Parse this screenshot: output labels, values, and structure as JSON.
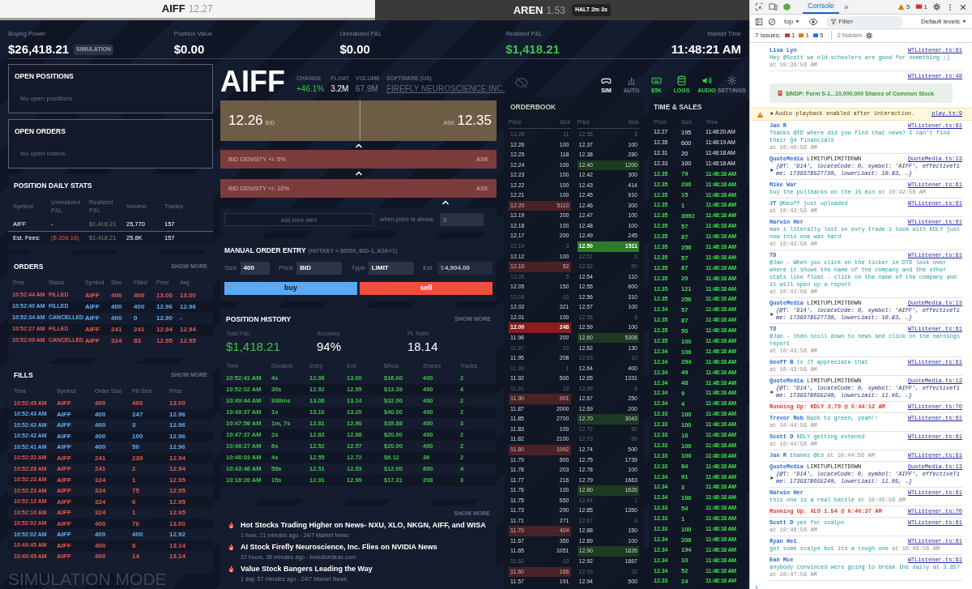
{
  "symbol_tabs": [
    {
      "symbol": "AIFF",
      "price": "12.27",
      "selected": true
    },
    {
      "symbol": "AREN",
      "price": "1.53",
      "badge": "HALT 2m 3s",
      "selected": false
    }
  ],
  "account": [
    {
      "label": "Buying Power",
      "value": "$26,418.21",
      "badge": "SIMULATION",
      "positive": false
    },
    {
      "label": "Position Value",
      "value": "$0.00",
      "positive": false
    },
    {
      "label": "Unrealized P&L",
      "value": "$0.00",
      "positive": false
    },
    {
      "label": "Realized P&L",
      "value": "$1,418.21",
      "positive": true
    },
    {
      "label": "Market Time",
      "value": "11:48:21 AM",
      "positive": false
    }
  ],
  "ticker": {
    "symbol": "AIFF",
    "stats": [
      {
        "label": "CHANGE",
        "value": "+46.1%",
        "positive": true,
        "muted": false
      },
      {
        "label": "FLOAT",
        "value": "3.2M",
        "positive": false,
        "muted": false
      },
      {
        "label": "VOLUME",
        "value": "67.9M",
        "positive": false,
        "muted": true
      }
    ],
    "company_label": "SOFTWARE (US)",
    "company": "FIREFLY NEUROSCIENCE INC.",
    "tools": [
      {
        "label": "SIM",
        "kind": "gamepad",
        "active": false,
        "muted": false
      },
      {
        "label": "AUTO",
        "kind": "chart",
        "active": false,
        "muted": true
      },
      {
        "label": "$5K",
        "kind": "keyboard",
        "active": true,
        "muted": false
      },
      {
        "label": "LOGS",
        "kind": "database",
        "active": true,
        "muted": false
      },
      {
        "label": "AUDIO",
        "kind": "speaker",
        "active": true,
        "muted": false
      },
      {
        "label": "SETTINGS",
        "kind": "gear",
        "active": false,
        "muted": true
      }
    ]
  },
  "quote": {
    "bid": "12.26",
    "bid_label": "BID",
    "ask_label": "ASK",
    "ask": "12.35"
  },
  "density": [
    {
      "label": "BID DENSITY +/- 5%",
      "right": "ASK"
    },
    {
      "label": "BID DENSITY +/- 10%",
      "right": "ASK"
    }
  ],
  "price_alert": {
    "placeholder": "add price alert",
    "condition": "when price is above",
    "price_placeholder": "$"
  },
  "order_entry": {
    "title": "MANUAL ORDER ENTRY",
    "hint": "(HOTKEY = $5000, BID-1, ASK+1)",
    "fields": [
      {
        "label": "Size",
        "value": "400",
        "disabled": false
      },
      {
        "label": "Price",
        "value": "BID",
        "disabled": false
      },
      {
        "label": "Type",
        "value": "LIMIT",
        "disabled": false
      },
      {
        "label": "Est.",
        "prefix": "$",
        "value": "4,904.00",
        "disabled": true
      }
    ],
    "buttons": [
      {
        "label": "buy",
        "kind": "buy"
      },
      {
        "label": "sell",
        "kind": "sell"
      }
    ]
  },
  "position_history": {
    "title": "POSITION HISTORY",
    "show_more": "SHOW MORE",
    "summary": [
      {
        "label": "Total P&L",
        "value": "$1,418.21",
        "positive": true
      },
      {
        "label": "Accuracy",
        "value": "94%",
        "positive": false
      },
      {
        "label": "PL Ratio",
        "value": "18.14",
        "positive": false
      }
    ],
    "columns": [
      "Time",
      "Duration",
      "Entry",
      "Exit",
      "$Real",
      "Shares",
      "Trades"
    ],
    "rows": [
      [
        "10:52:41 AM",
        "4s",
        "12.96",
        "13.00",
        "$16.00",
        "400",
        "2"
      ],
      [
        "10:52:02 AM",
        "30s",
        "12.92",
        "12.95",
        "$13.39",
        "400",
        "4"
      ],
      [
        "10:49:44 AM",
        "938ms",
        "13.06",
        "13.14",
        "$32.00",
        "400",
        "2"
      ],
      [
        "10:49:37 AM",
        "1s",
        "13.10",
        "13.20",
        "$40.00",
        "400",
        "2"
      ],
      [
        "10:47:56 AM",
        "1m, 7s",
        "12.81",
        "12.90",
        "$35.88",
        "400",
        "3"
      ],
      [
        "10:47:37 AM",
        "2s",
        "12.83",
        "12.88",
        "$20.00",
        "400",
        "2"
      ],
      [
        "10:46:27 AM",
        "6s",
        "12.52",
        "12.57",
        "$20.00",
        "400",
        "2"
      ],
      [
        "10:46:03 AM",
        "4s",
        "12.55",
        "12.72",
        "$6.12",
        "36",
        "2"
      ],
      [
        "10:43:46 AM",
        "58s",
        "12.51",
        "12.53",
        "$12.00",
        "800",
        "4"
      ],
      [
        "10:18:20 AM",
        "15s",
        "12.91",
        "12.99",
        "$17.31",
        "208",
        "3"
      ]
    ],
    "more": "..."
  },
  "news": {
    "show_more": "SHOW MORE",
    "items": [
      {
        "title": "Hot Stocks Trading Higher on News- NXU, XLO, NKGN, AIFF, and WISA",
        "meta": "1 hour, 21 minutes ago - 24/7 Market News"
      },
      {
        "title": "AI Stock Firefly Neuroscience, Inc. Flies on NVIDIA News",
        "meta": "22 hours, 38 minutes ago - Investorideas.com"
      },
      {
        "title": "Value Stock Bangers Leading the Way",
        "meta": "1 day, 57 minutes ago - 24/7 Market News"
      }
    ]
  },
  "empty_panels": [
    {
      "title": "OPEN POSITIONS",
      "empty": "No open positions."
    },
    {
      "title": "OPEN ORDERS",
      "empty": "No open orders."
    }
  ],
  "daily_stats": {
    "title": "POSITION DAILY STATS",
    "columns": [
      "Symbol",
      "Unrealized P&L",
      "Realized P&L",
      "Volume",
      "Trades"
    ],
    "rows": [
      {
        "kind": "position",
        "cells": [
          "AIFF",
          "-",
          "$1,418.21",
          "25,770",
          "157"
        ]
      },
      {
        "kind": "fees",
        "cells": [
          "Est. Fees:",
          "($-206.16)",
          "$1,418.21",
          "25.8K",
          "157"
        ]
      }
    ]
  },
  "orders": {
    "title": "ORDERS",
    "show_more": "SHOW MORE",
    "columns": [
      "Time",
      "Status",
      "Symbol",
      "Size",
      "Filled",
      "Price",
      "Avg"
    ],
    "rows": [
      {
        "kind": "sell",
        "cells": [
          "10:52:44 AM",
          "FILLED",
          "AIFF",
          "400",
          "400",
          "13.00",
          "13.00"
        ]
      },
      {
        "kind": "buy",
        "cells": [
          "10:52:40 AM",
          "FILLED",
          "AIFF",
          "400",
          "400",
          "12.96",
          "12.96"
        ]
      },
      {
        "kind": "buy",
        "cells": [
          "10:52:34 AM",
          "CANCELLED",
          "AIFF",
          "400",
          "0",
          "12.90",
          "-"
        ]
      },
      {
        "kind": "sell",
        "cells": [
          "10:52:27 AM",
          "FILLED",
          "AIFF",
          "241",
          "241",
          "12.94",
          "12.94"
        ]
      },
      {
        "kind": "sell",
        "cells": [
          "10:52:09 AM",
          "CANCELLED",
          "AIFF",
          "324",
          "83",
          "12.95",
          "12.95"
        ]
      }
    ],
    "more": "..."
  },
  "fills": {
    "title": "FILLS",
    "show_more": "SHOW MORE",
    "columns": [
      "Time",
      "Symbol",
      "Order Size",
      "Fill Size",
      "Price"
    ],
    "rows": [
      {
        "kind": "sell",
        "cells": [
          "10:52:45 AM",
          "AIFF",
          "400",
          "400",
          "13.00"
        ]
      },
      {
        "kind": "buy",
        "cells": [
          "10:52:43 AM",
          "AIFF",
          "400",
          "247",
          "12.96"
        ]
      },
      {
        "kind": "buy",
        "cells": [
          "10:52:42 AM",
          "AIFF",
          "400",
          "3",
          "12.96"
        ]
      },
      {
        "kind": "buy",
        "cells": [
          "10:52:42 AM",
          "AIFF",
          "400",
          "100",
          "12.96"
        ]
      },
      {
        "kind": "buy",
        "cells": [
          "10:52:41 AM",
          "AIFF",
          "400",
          "50",
          "12.96"
        ]
      },
      {
        "kind": "sell",
        "cells": [
          "10:52:32 AM",
          "AIFF",
          "241",
          "239",
          "12.94"
        ]
      },
      {
        "kind": "sell",
        "cells": [
          "10:52:28 AM",
          "AIFF",
          "241",
          "2",
          "12.94"
        ]
      },
      {
        "kind": "sell",
        "cells": [
          "10:52:23 AM",
          "AIFF",
          "324",
          "1",
          "12.95"
        ]
      },
      {
        "kind": "sell",
        "cells": [
          "10:52:23 AM",
          "AIFF",
          "324",
          "75",
          "12.95"
        ]
      },
      {
        "kind": "sell",
        "cells": [
          "10:52:12 AM",
          "AIFF",
          "324",
          "6",
          "12.95"
        ]
      },
      {
        "kind": "sell",
        "cells": [
          "10:52:10 AM",
          "AIFF",
          "324",
          "1",
          "12.95"
        ]
      },
      {
        "kind": "sell",
        "cells": [
          "10:52:02 AM",
          "AIFF",
          "400",
          "76",
          "13.00"
        ]
      },
      {
        "kind": "buy",
        "cells": [
          "10:52:02 AM",
          "AIFF",
          "400",
          "400",
          "12.92"
        ]
      },
      {
        "kind": "sell",
        "cells": [
          "10:49:45 AM",
          "AIFF",
          "400",
          "8",
          "13.14"
        ]
      },
      {
        "kind": "sell",
        "cells": [
          "10:49:45 AM",
          "AIFF",
          "400",
          "14",
          "13.14"
        ]
      }
    ],
    "more": "..."
  },
  "simulation_banner": "SIMULATION MODE",
  "orderbook": {
    "title": "ORDERBOOK",
    "columns": [
      "Price",
      "Size",
      "Price",
      "Size"
    ],
    "bids": [
      {
        "price": "12.26",
        "size": "11",
        "kind": "dim"
      },
      {
        "price": "12.26",
        "size": "100",
        "kind": "plain"
      },
      {
        "price": "12.25",
        "size": "118",
        "kind": "plain"
      },
      {
        "price": "12.24",
        "size": "100",
        "kind": "plain"
      },
      {
        "price": "12.23",
        "size": "100",
        "kind": "plain"
      },
      {
        "price": "12.22",
        "size": "100",
        "kind": "plain"
      },
      {
        "price": "12.21",
        "size": "100",
        "kind": "plain"
      },
      {
        "price": "12.20",
        "size": "5110",
        "kind": "tint"
      },
      {
        "price": "12.19",
        "size": "200",
        "kind": "plain"
      },
      {
        "price": "12.18",
        "size": "100",
        "kind": "plain"
      },
      {
        "price": "12.17",
        "size": "200",
        "kind": "plain"
      },
      {
        "price": "12.14",
        "size": "3",
        "kind": "dim"
      },
      {
        "price": "12.12",
        "size": "100",
        "kind": "plain"
      },
      {
        "price": "12.10",
        "size": "52",
        "kind": "tint"
      },
      {
        "price": "12.09",
        "size": "5",
        "kind": "dim"
      },
      {
        "price": "12.05",
        "size": "150",
        "kind": "plain"
      },
      {
        "price": "12.04",
        "size": "10",
        "kind": "dim"
      },
      {
        "price": "12.02",
        "size": "321",
        "kind": "plain"
      },
      {
        "price": "12.01",
        "size": "100",
        "kind": "plain"
      },
      {
        "price": "12.00",
        "size": "248",
        "kind": "strong"
      },
      {
        "price": "11.98",
        "size": "200",
        "kind": "plain"
      },
      {
        "price": "11.97",
        "size": "10",
        "kind": "dim"
      },
      {
        "price": "11.95",
        "size": "208",
        "kind": "plain"
      },
      {
        "price": "11.93",
        "size": "1",
        "kind": "dim"
      },
      {
        "price": "11.92",
        "size": "500",
        "kind": "plain"
      },
      {
        "price": "11.91",
        "size": "10",
        "kind": "dim"
      },
      {
        "price": "11.90",
        "size": "901",
        "kind": "tint"
      },
      {
        "price": "11.87",
        "size": "2000",
        "kind": "plain"
      },
      {
        "price": "11.85",
        "size": "2700",
        "kind": "plain"
      },
      {
        "price": "11.83",
        "size": "100",
        "kind": "plain"
      },
      {
        "price": "11.82",
        "size": "2100",
        "kind": "plain"
      },
      {
        "price": "11.80",
        "size": "1092",
        "kind": "tint"
      },
      {
        "price": "11.79",
        "size": "500",
        "kind": "plain"
      },
      {
        "price": "11.78",
        "size": "203",
        "kind": "plain"
      },
      {
        "price": "11.77",
        "size": "216",
        "kind": "plain"
      },
      {
        "price": "11.76",
        "size": "100",
        "kind": "plain"
      },
      {
        "price": "11.75",
        "size": "650",
        "kind": "plain"
      },
      {
        "price": "11.73",
        "size": "290",
        "kind": "plain"
      },
      {
        "price": "11.71",
        "size": "271",
        "kind": "plain"
      },
      {
        "price": "11.70",
        "size": "404",
        "kind": "tint"
      },
      {
        "price": "11.67",
        "size": "350",
        "kind": "plain"
      },
      {
        "price": "11.65",
        "size": "1051",
        "kind": "plain"
      },
      {
        "price": "11.61",
        "size": "10",
        "kind": "dim"
      },
      {
        "price": "11.60",
        "size": "166",
        "kind": "tint"
      },
      {
        "price": "11.57",
        "size": "191",
        "kind": "plain"
      }
    ],
    "asks": [
      {
        "price": "12.35",
        "size": "3",
        "kind": "dim"
      },
      {
        "price": "12.37",
        "size": "100",
        "kind": "plain"
      },
      {
        "price": "12.38",
        "size": "280",
        "kind": "plain"
      },
      {
        "price": "12.40",
        "size": "1200",
        "kind": "tint"
      },
      {
        "price": "12.42",
        "size": "300",
        "kind": "plain"
      },
      {
        "price": "12.43",
        "size": "414",
        "kind": "plain"
      },
      {
        "price": "12.45",
        "size": "910",
        "kind": "plain"
      },
      {
        "price": "12.46",
        "size": "300",
        "kind": "plain"
      },
      {
        "price": "12.47",
        "size": "100",
        "kind": "plain"
      },
      {
        "price": "12.48",
        "size": "100",
        "kind": "plain"
      },
      {
        "price": "12.49",
        "size": "245",
        "kind": "plain"
      },
      {
        "price": "12.50",
        "size": "1511",
        "kind": "strong"
      },
      {
        "price": "12.51",
        "size": "2",
        "kind": "dim"
      },
      {
        "price": "12.52",
        "size": "50",
        "kind": "dim"
      },
      {
        "price": "12.54",
        "size": "110",
        "kind": "plain"
      },
      {
        "price": "12.55",
        "size": "600",
        "kind": "plain"
      },
      {
        "price": "12.56",
        "size": "310",
        "kind": "plain"
      },
      {
        "price": "12.57",
        "size": "100",
        "kind": "plain"
      },
      {
        "price": "12.58",
        "size": "5",
        "kind": "dim"
      },
      {
        "price": "12.59",
        "size": "100",
        "kind": "plain"
      },
      {
        "price": "12.60",
        "size": "5308",
        "kind": "tint"
      },
      {
        "price": "12.62",
        "size": "130",
        "kind": "plain"
      },
      {
        "price": "12.63",
        "size": "10",
        "kind": "dim"
      },
      {
        "price": "12.64",
        "size": "400",
        "kind": "plain"
      },
      {
        "price": "12.65",
        "size": "1331",
        "kind": "plain"
      },
      {
        "price": "12.66",
        "size": "8",
        "kind": "dim"
      },
      {
        "price": "12.67",
        "size": "250",
        "kind": "plain"
      },
      {
        "price": "12.69",
        "size": "200",
        "kind": "plain"
      },
      {
        "price": "12.70",
        "size": "3043",
        "kind": "tint"
      },
      {
        "price": "12.72",
        "size": "50",
        "kind": "dim"
      },
      {
        "price": "12.73",
        "size": "50",
        "kind": "dim"
      },
      {
        "price": "12.74",
        "size": "500",
        "kind": "plain"
      },
      {
        "price": "12.75",
        "size": "1739",
        "kind": "plain"
      },
      {
        "price": "12.78",
        "size": "100",
        "kind": "plain"
      },
      {
        "price": "12.79",
        "size": "1663",
        "kind": "plain"
      },
      {
        "price": "12.80",
        "size": "1626",
        "kind": "tint"
      },
      {
        "price": "12.84",
        "size": "1",
        "kind": "dim"
      },
      {
        "price": "12.85",
        "size": "1350",
        "kind": "plain"
      },
      {
        "price": "12.87",
        "size": "3",
        "kind": "dim"
      },
      {
        "price": "12.88",
        "size": "150",
        "kind": "plain"
      },
      {
        "price": "12.89",
        "size": "100",
        "kind": "plain"
      },
      {
        "price": "12.90",
        "size": "1826",
        "kind": "tint"
      },
      {
        "price": "12.92",
        "size": "1867",
        "kind": "plain"
      },
      {
        "price": "12.93",
        "size": "32",
        "kind": "dim"
      },
      {
        "price": "12.94",
        "size": "500",
        "kind": "plain"
      }
    ]
  },
  "time_sales": {
    "title": "TIME & SALES",
    "columns": [
      "Price",
      "Size",
      "Time"
    ],
    "rows": [
      {
        "price": "12.27",
        "size": "195",
        "time": "11:48:20 AM",
        "kind": "plain"
      },
      {
        "price": "12.35",
        "size": "600",
        "time": "11:48:19 AM",
        "kind": "plain"
      },
      {
        "price": "12.31",
        "size": "20",
        "time": "11:48:18 AM",
        "kind": "plain"
      },
      {
        "price": "12.33",
        "size": "100",
        "time": "11:48:18 AM",
        "kind": "plain"
      },
      {
        "price": "12.35",
        "size": "79",
        "time": "11:48:18 AM",
        "kind": "ask"
      },
      {
        "price": "12.35",
        "size": "200",
        "time": "11:48:18 AM",
        "kind": "ask"
      },
      {
        "price": "12.35",
        "size": "15",
        "time": "11:48:18 AM",
        "kind": "ask"
      },
      {
        "price": "12.35",
        "size": "1",
        "time": "11:48:18 AM",
        "kind": "ask"
      },
      {
        "price": "12.35",
        "size": "3992",
        "time": "11:48:18 AM",
        "kind": "ask"
      },
      {
        "price": "12.35",
        "size": "57",
        "time": "11:48:18 AM",
        "kind": "ask"
      },
      {
        "price": "12.35",
        "size": "87",
        "time": "11:48:18 AM",
        "kind": "ask"
      },
      {
        "price": "12.35",
        "size": "256",
        "time": "11:48:18 AM",
        "kind": "ask"
      },
      {
        "price": "12.35",
        "size": "57",
        "time": "11:48:18 AM",
        "kind": "ask"
      },
      {
        "price": "12.35",
        "size": "87",
        "time": "11:48:18 AM",
        "kind": "ask"
      },
      {
        "price": "12.35",
        "size": "20",
        "time": "11:48:18 AM",
        "kind": "ask"
      },
      {
        "price": "12.35",
        "size": "121",
        "time": "11:48:18 AM",
        "kind": "ask"
      },
      {
        "price": "12.35",
        "size": "256",
        "time": "11:48:18 AM",
        "kind": "ask"
      },
      {
        "price": "12.34",
        "size": "57",
        "time": "11:48:18 AM",
        "kind": "ask"
      },
      {
        "price": "12.35",
        "size": "87",
        "time": "11:48:18 AM",
        "kind": "ask"
      },
      {
        "price": "12.35",
        "size": "50",
        "time": "11:48:18 AM",
        "kind": "ask"
      },
      {
        "price": "12.35",
        "size": "100",
        "time": "11:48:18 AM",
        "kind": "ask"
      },
      {
        "price": "12.34",
        "size": "106",
        "time": "11:48:18 AM",
        "kind": "ask"
      },
      {
        "price": "12.34",
        "size": "294",
        "time": "11:48:18 AM",
        "kind": "ask"
      },
      {
        "price": "12.34",
        "size": "49",
        "time": "11:48:18 AM",
        "kind": "ask"
      },
      {
        "price": "12.34",
        "size": "48",
        "time": "11:48:18 AM",
        "kind": "ask"
      },
      {
        "price": "12.34",
        "size": "9",
        "time": "11:48:18 AM",
        "kind": "ask"
      },
      {
        "price": "12.34",
        "size": "4",
        "time": "11:48:18 AM",
        "kind": "ask"
      },
      {
        "price": "12.33",
        "size": "100",
        "time": "11:48:18 AM",
        "kind": "ask"
      },
      {
        "price": "12.33",
        "size": "100",
        "time": "11:48:18 AM",
        "kind": "ask"
      },
      {
        "price": "12.33",
        "size": "16",
        "time": "11:48:18 AM",
        "kind": "ask"
      },
      {
        "price": "12.33",
        "size": "100",
        "time": "11:48:18 AM",
        "kind": "ask"
      },
      {
        "price": "12.33",
        "size": "100",
        "time": "11:48:18 AM",
        "kind": "ask"
      },
      {
        "price": "12.33",
        "size": "84",
        "time": "11:48:18 AM",
        "kind": "ask"
      },
      {
        "price": "12.34",
        "size": "91",
        "time": "11:48:18 AM",
        "kind": "ask"
      },
      {
        "price": "12.34",
        "size": "3",
        "time": "11:48:18 AM",
        "kind": "ask"
      },
      {
        "price": "12.34",
        "size": "100",
        "time": "11:48:18 AM",
        "kind": "ask"
      },
      {
        "price": "12.33",
        "size": "54",
        "time": "11:48:18 AM",
        "kind": "ask"
      },
      {
        "price": "12.33",
        "size": "1",
        "time": "11:48:18 AM",
        "kind": "ask"
      },
      {
        "price": "12.33",
        "size": "100",
        "time": "11:48:18 AM",
        "kind": "ask"
      },
      {
        "price": "12.34",
        "size": "206",
        "time": "11:48:18 AM",
        "kind": "ask"
      },
      {
        "price": "12.34",
        "size": "194",
        "time": "11:48:18 AM",
        "kind": "ask"
      },
      {
        "price": "12.34",
        "size": "10",
        "time": "11:48:18 AM",
        "kind": "ask"
      },
      {
        "price": "12.34",
        "size": "52",
        "time": "11:48:18 AM",
        "kind": "ask"
      },
      {
        "price": "12.33",
        "size": "24",
        "time": "11:48:18 AM",
        "kind": "ask"
      }
    ]
  },
  "devtools": {
    "tabs": [
      {
        "label": "Console",
        "selected": true
      }
    ],
    "more": "»",
    "warnings": "5",
    "errors": "1",
    "context": "top",
    "filter_placeholder": "Filter",
    "levels": "Default levels",
    "issues_label": "7 Issues:",
    "issue_counts": [
      {
        "kind": "error",
        "count": "1"
      },
      {
        "kind": "warning",
        "count": "1"
      },
      {
        "kind": "info",
        "count": "5"
      }
    ],
    "hidden": "2 hidden",
    "messages": [
      {
        "kind": "chat",
        "user": "Lisa Lyn",
        "text": "Hey @Scott we old-schoolers are good for something ;)",
        "time": "at 10:39:56 AM",
        "source": "WTListener.ts:61",
        "beside": false,
        "time_inline": false
      },
      {
        "kind": "news",
        "text": "$INDP: Form S-1...10,000,000 Shares of Common Stock",
        "source": "WTListener.ts:48"
      },
      {
        "kind": "warning",
        "text": "Audio playback enabled after interaction.",
        "source": "play.ts:9"
      },
      {
        "kind": "chat",
        "user": "Jan R",
        "text": "Thanks @TD where did you find that news? I can't find their Q4 financials",
        "time": "at 10:40:56 AM",
        "source": "WTListener.ts:61",
        "beside": false,
        "time_inline": false
      },
      {
        "kind": "object",
        "label": "QuoteMedia",
        "event": "LIMITUPLIMITDOWN",
        "preview": "{@T: 'D14', locateCode: 0, symbol: 'AIFF', effectiveTime: 1739378527730, lowerLimit: 10.83, …}",
        "source": "QuoteMedia.ts:13"
      },
      {
        "kind": "chat",
        "user": "Mike War",
        "text": "buy the pullbacks on the 15 min",
        "time": "at 10:42:56 AM",
        "source": "WTListener.ts:61",
        "beside": false,
        "time_inline": true
      },
      {
        "kind": "chat",
        "user": "JT",
        "text": "@Geoff just uploaded",
        "time": "at 10:42:56 AM",
        "source": "WTListener.ts:61",
        "beside": true,
        "time_inline": false
      },
      {
        "kind": "chat",
        "user": "Harwin Her",
        "text": "man i literally lost on evry trade i took with KDLY just now this one was hard",
        "time": "at 10:42:56 AM",
        "source": "WTListener.ts:61",
        "beside": false,
        "time_inline": false
      },
      {
        "kind": "chat",
        "user": "TD",
        "text": "@Jan - When you click on the ticker in DTD look over where it shows the name of the company and the other stats like float - click on the name of the company and it will open up a report",
        "time": "at 10:42:56 AM",
        "source": "WTListener.ts:61",
        "beside": false,
        "time_inline": false
      },
      {
        "kind": "object",
        "label": "QuoteMedia",
        "event": "LIMITUPLIMITDOWN",
        "preview": "{@T: 'D14', locateCode: 0, symbol: 'AIFF', effectiveTime: 1739378527730, lowerLimit: 10.83, …}",
        "source": "QuoteMedia.ts:13"
      },
      {
        "kind": "chat",
        "user": "TD",
        "text": "@Jan - then scoll down to news and click on the earnings report",
        "time": "at 10:43:56 AM",
        "source": "WTListener.ts:61",
        "beside": false,
        "time_inline": false
      },
      {
        "kind": "chat",
        "user": "Geoff B",
        "text": "tx JT appreciate that",
        "time": "at 10:43:56 AM",
        "source": "WTListener.ts:61",
        "beside": true,
        "time_inline": false
      },
      {
        "kind": "object",
        "label": "QuoteMedia",
        "event": "LIMITUPLIMITDOWN",
        "preview": "{@T: 'D14', locateCode: 0, symbol: 'AIFF', effectiveTime: 1739378655240, lowerLimit: 11.05, …}",
        "source": "QuoteMedia.ts:13"
      },
      {
        "kind": "alert",
        "text": "Running Up: KDLY 3.79 @ 6:44:12 AM",
        "source": "WTListener.ts:70"
      },
      {
        "kind": "chat",
        "user": "Trevor Rob",
        "text": "Back to green, yeah!!",
        "time": "at 10:44:56 AM",
        "source": "WTListener.ts:61",
        "beside": true,
        "time_inline": false
      },
      {
        "kind": "chat",
        "user": "Scott D",
        "text": "KDLY getting extened",
        "time": "at 10:44:56 AM",
        "source": "WTListener.ts:61",
        "beside": true,
        "time_inline": false
      },
      {
        "kind": "chat",
        "user": "Jan R",
        "text": "thanks @td",
        "time": "at 10:44:56 AM",
        "source": "WTListener.ts:61",
        "beside": true,
        "time_inline": true
      },
      {
        "kind": "object",
        "label": "QuoteMedia",
        "event": "LIMITUPLIMITDOWN",
        "preview": "{@T: 'D14', locateCode: 0, symbol: 'AIFF', effectiveTime: 1739378655240, lowerLimit: 11.05, …}",
        "source": "QuoteMedia.ts:13"
      },
      {
        "kind": "chat",
        "user": "Harwin Her",
        "text": "this one is a real battle",
        "time": "at 10:45:56 AM",
        "source": "WTListener.ts:61",
        "beside": false,
        "time_inline": true
      },
      {
        "kind": "alert",
        "text": "Running Up: XLO 1.54 @ 6:46:37 AM",
        "source": "WTListener.ts:70"
      },
      {
        "kind": "chat",
        "user": "Scott D",
        "text": "yes for scalps",
        "time": "at 10:46:56 AM",
        "source": "WTListener.ts:61",
        "beside": true,
        "time_inline": false
      },
      {
        "kind": "chat",
        "user": "Ryan Hei",
        "text": "got some scalps but its a tough one",
        "time": "at 10:46:56 AM",
        "source": "WTListener.ts:61",
        "beside": false,
        "time_inline": true
      },
      {
        "kind": "chat",
        "user": "Ean Mce",
        "text": "anybody convinced were going to break the daily at 3.85?",
        "time": "at 10:47:56 AM",
        "source": "WTListener.ts:61",
        "beside": false,
        "time_inline": false
      }
    ]
  }
}
